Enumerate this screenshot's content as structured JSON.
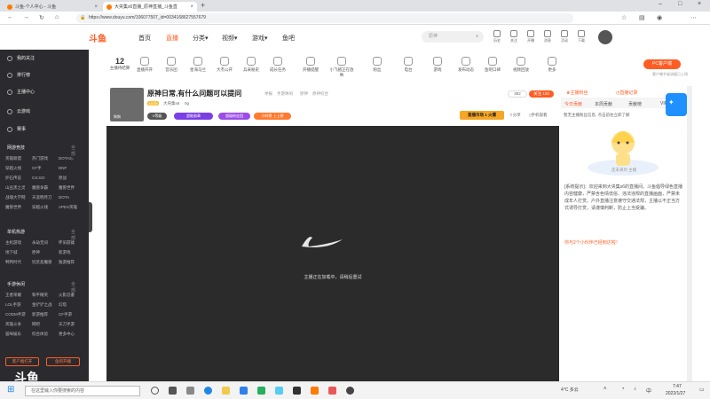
{
  "browser": {
    "tabs": [
      {
        "label": "斗鱼-个人中心 - 斗鱼"
      },
      {
        "label": "大央集s6直播_原神直播_斗鱼直"
      }
    ],
    "address": "https://www.douyu.com/106077507_id=0034168627557679"
  },
  "site": {
    "logo": "斗鱼",
    "nav": [
      "首页",
      "直播",
      "分类▾",
      "视频▾",
      "游戏▾",
      "鱼吧"
    ],
    "search_placeholder": "原神",
    "header_icons": [
      "历史",
      "关注",
      "开播",
      "消息",
      "活动",
      "下载"
    ]
  },
  "sidebar": {
    "top_items": [
      "我的关注",
      "排行榜",
      "主播中心",
      "云游戏",
      "赛事"
    ],
    "sections": [
      {
        "title": "网游竞技",
        "more": "全部 >",
        "items": [
          "英雄联盟",
          "热门游戏",
          "DOTA2",
          "穿越火线",
          "CF手",
          "DNF",
          "炉石传说",
          "CS:GO",
          "原战",
          "山豆黑之灵",
          "魔兽争霸",
          "魔兽世界",
          "战魂大学网",
          "天涯明月刀",
          "DOTA",
          "魔兽世界",
          "穿越火线",
          "APEX英雄"
        ]
      },
      {
        "title": "单机热游",
        "more": "全部 >",
        "items": [
          "主机游戏",
          "永劫无间",
          "怀旧游戏",
          "地下城",
          "原神",
          "新游戏",
          "鸭鸭时代",
          "饥荒恶魔兽",
          "独游推荐"
        ]
      },
      {
        "title": "手游休闲",
        "more": "全部 >",
        "items": [
          "王者荣耀",
          "和平精英",
          "火影忍者",
          "LOL手游",
          "金铲铲之战",
          "幻塔",
          "CODM手游",
          "新游推荐",
          "CF手游",
          "英雄斗争",
          "网吧",
          "天刀手游",
          "猫咪娱乐",
          "综合体验",
          "更多中心"
        ]
      }
    ],
    "buttons": [
      "客户端打开",
      "鱼吧开播"
    ],
    "bottom_logo": "斗鱼"
  },
  "categories": [
    {
      "label": "主播待结算",
      "count": "12"
    },
    {
      "label": "直播开开"
    },
    {
      "label": "音乐团"
    },
    {
      "label": "星海马兰"
    },
    {
      "label": "大杰公开"
    },
    {
      "label": "兵采秘史"
    },
    {
      "label": "成长任务"
    },
    {
      "label": "开播提醒"
    },
    {
      "label": "小飞猪正在放映"
    },
    {
      "label": "粉丝"
    },
    {
      "label": "电台"
    },
    {
      "label": "游戏"
    },
    {
      "label": "发布动态"
    },
    {
      "label": "鱼吧口碑"
    },
    {
      "label": "视频回放"
    },
    {
      "label": "更多"
    }
  ],
  "pc_button": "PC客户端",
  "pc_sub": "客户端节省流量已上线",
  "room": {
    "title": "原神日常,有什么问题可以提问",
    "report": "举报",
    "meta": [
      "手游休闲",
      "原神",
      "原神综合"
    ],
    "level": "LV25",
    "streamer": "大央集s6",
    "followers": "0g",
    "fans": "382",
    "follow_label": "关注",
    "follow_count": "102",
    "avatar_caption": "狗狗"
  },
  "pills": [
    "V等级",
    "超能勋章",
    "超级粉丝团",
    "小时榜 上上榜"
  ],
  "ranking_badge": "直播市场 1 火爆",
  "share": "分享",
  "phone_watch": "手机观看",
  "video": {
    "loading_text": "主播正在加载中，请稍后重试"
  },
  "right_panel": {
    "top_tabs": [
      "主播粉丝",
      "直播记录"
    ],
    "tabs": [
      "今日贡献",
      "本周贡献",
      "贡献榜",
      "VIP"
    ],
    "notice": "暂无主播粉丝信息, 点击前往立即了解",
    "promo_caption": "还未来到 主播",
    "chat_1": "[系统提示]：欢迎来到大央集s6的直播间。斗鱼倡导绿色直播内容健康，严禁含色情低俗、违法违规的直播画面，严禁未成年人打赏。户外直播注意遵守交通法规，主播以不正当方式诱导打赏，请谨慎判断，防止上当受骗。",
    "chat_2": "你与2个小伙伴已经到达啦！"
  },
  "taskbar": {
    "search_placeholder": "在这里输入你要搜索的内容",
    "time": "7:47",
    "date": "2022/1/27",
    "weather": "4°C 多云"
  }
}
